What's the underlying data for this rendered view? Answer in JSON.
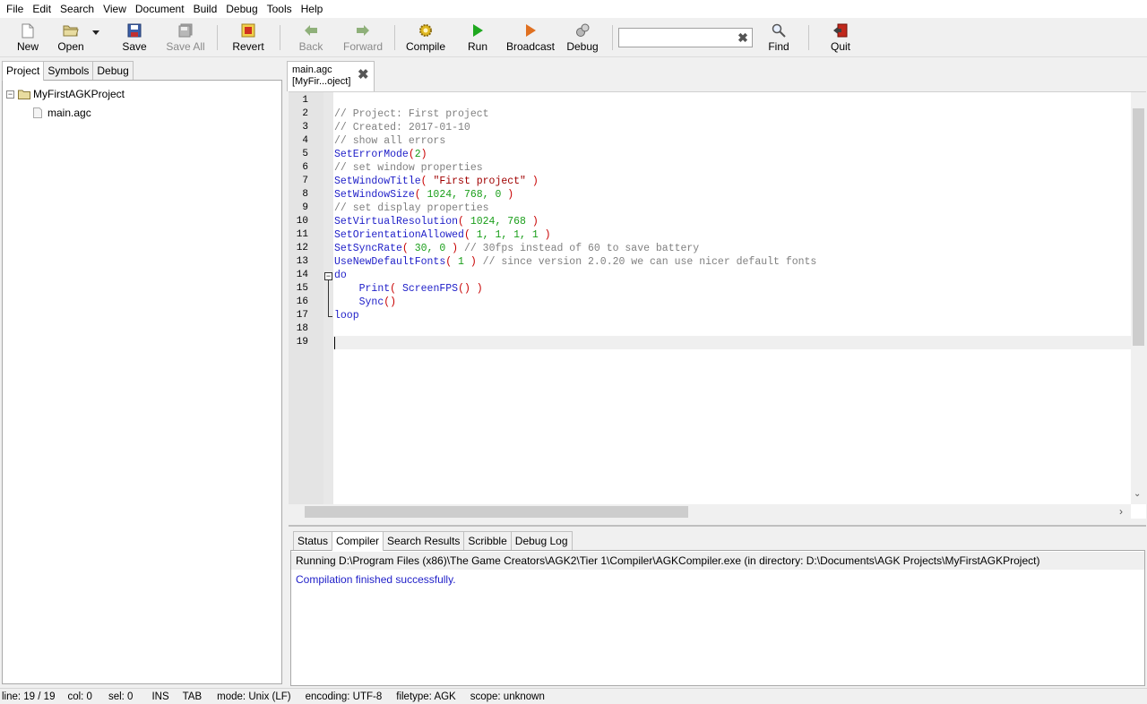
{
  "menu": [
    "File",
    "Edit",
    "Search",
    "View",
    "Document",
    "Build",
    "Debug",
    "Tools",
    "Help"
  ],
  "toolbar": {
    "new": "New",
    "open": "Open",
    "save": "Save",
    "save_all": "Save All",
    "revert": "Revert",
    "back": "Back",
    "forward": "Forward",
    "compile": "Compile",
    "run": "Run",
    "broadcast": "Broadcast",
    "debug": "Debug",
    "find": "Find",
    "quit": "Quit",
    "search_value": ""
  },
  "sidebar": {
    "tabs": [
      "Project",
      "Symbols",
      "Debug"
    ],
    "active_tab": "Project",
    "project_name": "MyFirstAGKProject",
    "files": [
      "main.agc"
    ]
  },
  "editor": {
    "tab_title_line1": "main.agc",
    "tab_title_line2": "[MyFir...oject]",
    "line_numbers": [
      "1",
      "2",
      "3",
      "4",
      "5",
      "6",
      "7",
      "8",
      "9",
      "10",
      "11",
      "12",
      "13",
      "14",
      "15",
      "16",
      "17",
      "18",
      "19"
    ],
    "fold_marker": "−"
  },
  "messages": {
    "tabs": [
      "Status",
      "Compiler",
      "Search Results",
      "Scribble",
      "Debug Log"
    ],
    "active_tab": "Compiler",
    "line1": "Running D:\\Program Files (x86)\\The Game Creators\\AGK2\\Tier 1\\Compiler\\AGKCompiler.exe (in directory: D:\\Documents\\AGK Projects\\MyFirstAGKProject)",
    "line2": "Compilation finished successfully."
  },
  "status": {
    "line": "line: 19 / 19",
    "col": "col: 0",
    "sel": "sel: 0",
    "ins": "INS",
    "tab": "TAB",
    "mode": "mode: Unix (LF)",
    "encoding": "encoding: UTF-8",
    "filetype": "filetype: AGK",
    "scope": "scope: unknown"
  },
  "colors": {
    "comment": "#808080",
    "function": "#1e1ec8",
    "number": "#1a9e1a",
    "string": "#a00000",
    "paren": "#c80000"
  }
}
